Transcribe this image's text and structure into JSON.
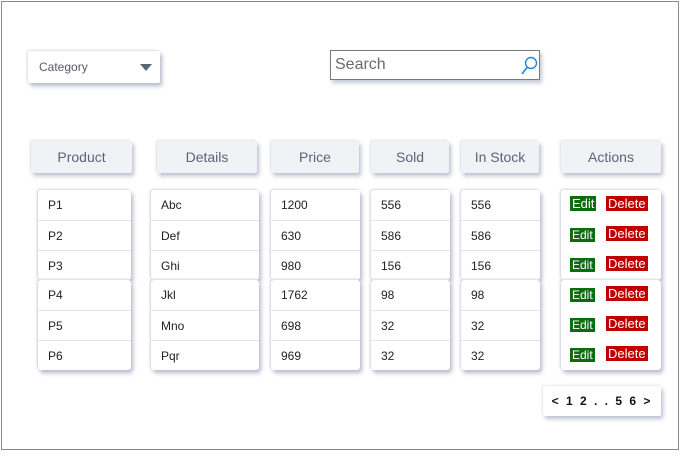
{
  "filter": {
    "category_label": "Category",
    "caret_icon": "caret-down-icon"
  },
  "search": {
    "placeholder": "Search",
    "icon": "search-icon",
    "icon_color": "#1e88d6"
  },
  "table": {
    "headers": {
      "product": "Product",
      "details": "Details",
      "price": "Price",
      "sold": "Sold",
      "in_stock": "In Stock",
      "actions": "Actions"
    },
    "rows": [
      {
        "product": "P1",
        "details": "Abc",
        "price": "1200",
        "sold": "556",
        "in_stock": "556"
      },
      {
        "product": "P2",
        "details": "Def",
        "price": "630",
        "sold": "586",
        "in_stock": "586"
      },
      {
        "product": "P3",
        "details": "Ghi",
        "price": "980",
        "sold": "156",
        "in_stock": "156"
      },
      {
        "product": "P4",
        "details": "Jkl",
        "price": "1762",
        "sold": "98",
        "in_stock": "98"
      },
      {
        "product": "P5",
        "details": "Mno",
        "price": "698",
        "sold": "32",
        "in_stock": "32"
      },
      {
        "product": "P6",
        "details": "Pqr",
        "price": "969",
        "sold": "32",
        "in_stock": "32"
      }
    ],
    "edit_label": "Edit",
    "delete_label": "Delete",
    "edit_color": "#0d6b10",
    "delete_color": "#c00000"
  },
  "pagination": {
    "text": "< 1 2 . . 5 6 >"
  }
}
